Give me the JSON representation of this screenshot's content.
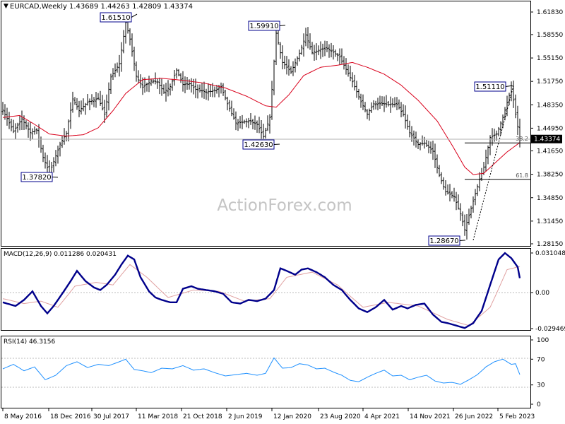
{
  "header": {
    "symbol": "EURCAD,Weekly",
    "ohlc": "1.43689 1.44263 1.42809 1.43374",
    "menu_glyph": "▼"
  },
  "watermark": "ActionForex.com",
  "colors": {
    "price": "#000000",
    "sma": "#d9001b",
    "macd": "#00008b",
    "signal": "#e0a0a0",
    "rsi": "#1e90ff",
    "label_border": "#00008b",
    "current_price_bg": "#000000"
  },
  "chart_data": [
    {
      "type": "bar",
      "title": "EURCAD,Weekly",
      "x_tick_labels": [
        "8 May 2016",
        "18 Dec 2016",
        "30 Jul 2017",
        "11 Mar 2018",
        "21 Oct 2018",
        "2 Jun 2019",
        "12 Jan 2020",
        "23 Aug 2020",
        "4 Apr 2021",
        "14 Nov 2021",
        "26 Jun 2022",
        "5 Feb 2023"
      ],
      "y_tick_labels": [
        "1.61830",
        "1.58550",
        "1.55150",
        "1.51750",
        "1.48350",
        "1.44950",
        "1.41650",
        "1.38250",
        "1.34850",
        "1.31450",
        "1.28150"
      ],
      "ylim": [
        1.2815,
        1.6183
      ],
      "current_price": "1.43374",
      "price_anchors": [
        [
          0,
          1.4757
        ],
        [
          5,
          1.445
        ],
        [
          9,
          1.463
        ],
        [
          13,
          1.443
        ],
        [
          16,
          1.4467
        ],
        [
          19,
          1.407
        ],
        [
          22,
          1.385
        ],
        [
          24,
          1.401
        ],
        [
          27,
          1.4264
        ],
        [
          30,
          1.442
        ],
        [
          33,
          1.492
        ],
        [
          36,
          1.475
        ],
        [
          40,
          1.487
        ],
        [
          45,
          1.493
        ],
        [
          48,
          1.47
        ],
        [
          51,
          1.524
        ],
        [
          55,
          1.543
        ],
        [
          58,
          1.603
        ],
        [
          60,
          1.579
        ],
        [
          63,
          1.525
        ],
        [
          66,
          1.509
        ],
        [
          70,
          1.518
        ],
        [
          73,
          1.517
        ],
        [
          76,
          1.502
        ],
        [
          79,
          1.51
        ],
        [
          82,
          1.534
        ],
        [
          85,
          1.513
        ],
        [
          88,
          1.514
        ],
        [
          91,
          1.506
        ],
        [
          96,
          1.502
        ],
        [
          100,
          1.504
        ],
        [
          103,
          1.51
        ],
        [
          106,
          1.485
        ],
        [
          110,
          1.457
        ],
        [
          113,
          1.458
        ],
        [
          116,
          1.46
        ],
        [
          120,
          1.455
        ],
        [
          123,
          1.437
        ],
        [
          126,
          1.465
        ],
        [
          129,
          1.5875
        ],
        [
          132,
          1.545
        ],
        [
          136,
          1.531
        ],
        [
          140,
          1.558
        ],
        [
          143,
          1.585
        ],
        [
          146,
          1.559
        ],
        [
          150,
          1.564
        ],
        [
          153,
          1.565
        ],
        [
          156,
          1.56
        ],
        [
          159,
          1.553
        ],
        [
          162,
          1.535
        ],
        [
          165,
          1.517
        ],
        [
          169,
          1.488
        ],
        [
          172,
          1.47
        ],
        [
          175,
          1.485
        ],
        [
          179,
          1.485
        ],
        [
          183,
          1.484
        ],
        [
          186,
          1.484
        ],
        [
          189,
          1.469
        ],
        [
          192,
          1.443
        ],
        [
          196,
          1.426
        ],
        [
          199,
          1.428
        ],
        [
          203,
          1.416
        ],
        [
          206,
          1.381
        ],
        [
          209,
          1.357
        ],
        [
          213,
          1.35
        ],
        [
          216,
          1.325
        ],
        [
          218,
          1.302
        ],
        [
          221,
          1.333
        ],
        [
          224,
          1.365
        ],
        [
          227,
          1.393
        ],
        [
          230,
          1.436
        ],
        [
          233,
          1.441
        ],
        [
          236,
          1.465
        ],
        [
          239,
          1.497
        ],
        [
          240,
          1.511
        ],
        [
          242,
          1.47
        ],
        [
          244,
          1.4337
        ]
      ],
      "sma_anchors": [
        [
          0,
          1.465
        ],
        [
          8,
          1.468
        ],
        [
          15,
          1.455
        ],
        [
          22,
          1.441
        ],
        [
          30,
          1.438
        ],
        [
          38,
          1.44
        ],
        [
          45,
          1.45
        ],
        [
          52,
          1.475
        ],
        [
          58,
          1.5
        ],
        [
          66,
          1.52
        ],
        [
          75,
          1.522
        ],
        [
          85,
          1.519
        ],
        [
          95,
          1.515
        ],
        [
          105,
          1.508
        ],
        [
          115,
          1.496
        ],
        [
          124,
          1.482
        ],
        [
          129,
          1.48
        ],
        [
          135,
          1.498
        ],
        [
          142,
          1.526
        ],
        [
          150,
          1.538
        ],
        [
          158,
          1.541
        ],
        [
          165,
          1.545
        ],
        [
          172,
          1.538
        ],
        [
          180,
          1.528
        ],
        [
          188,
          1.512
        ],
        [
          196,
          1.49
        ],
        [
          205,
          1.46
        ],
        [
          212,
          1.425
        ],
        [
          218,
          1.393
        ],
        [
          222,
          1.382
        ],
        [
          227,
          1.384
        ],
        [
          232,
          1.398
        ],
        [
          238,
          1.415
        ],
        [
          244,
          1.4286
        ]
      ],
      "annotations": [
        {
          "label": "1.61510",
          "price": 1.6151
        },
        {
          "label": "1.59910",
          "price": 1.5991
        },
        {
          "label": "1.51110",
          "price": 1.5111
        },
        {
          "label": "1.42630",
          "price": 1.4263
        },
        {
          "label": "1.37820",
          "price": 1.3782
        },
        {
          "label": "1.28670",
          "price": 1.2867
        }
      ],
      "fib_levels": [
        {
          "label": "38.2",
          "price": 1.4281
        },
        {
          "label": "61.8",
          "price": 1.3751
        }
      ]
    },
    {
      "type": "line",
      "title": "MACD(12,26,9) 0.011286 0.020431",
      "series": [
        {
          "name": "MACD"
        },
        {
          "name": "Signal"
        }
      ],
      "ylim": [
        -0.029469,
        0.031048
      ],
      "y_tick_labels": [
        "0.031048",
        "0.00",
        "-0.029469"
      ],
      "macd_anchors": [
        [
          0,
          -0.008
        ],
        [
          6,
          -0.011
        ],
        [
          10,
          -0.006
        ],
        [
          14,
          0.001
        ],
        [
          18,
          -0.011
        ],
        [
          21,
          -0.017
        ],
        [
          24,
          -0.011
        ],
        [
          28,
          -0.001
        ],
        [
          32,
          0.009
        ],
        [
          35,
          0.017
        ],
        [
          39,
          0.009
        ],
        [
          43,
          0.004
        ],
        [
          46,
          0.002
        ],
        [
          49,
          0.006
        ],
        [
          53,
          0.014
        ],
        [
          56,
          0.022
        ],
        [
          59,
          0.029
        ],
        [
          62,
          0.026
        ],
        [
          65,
          0.012
        ],
        [
          69,
          0.001
        ],
        [
          72,
          -0.004
        ],
        [
          75,
          -0.006
        ],
        [
          79,
          -0.008
        ],
        [
          82,
          -0.008
        ],
        [
          85,
          0.003
        ],
        [
          89,
          0.005
        ],
        [
          92,
          0.003
        ],
        [
          96,
          0.002
        ],
        [
          100,
          0.001
        ],
        [
          104,
          -0.001
        ],
        [
          108,
          -0.008
        ],
        [
          112,
          -0.009
        ],
        [
          116,
          -0.006
        ],
        [
          120,
          -0.007
        ],
        [
          124,
          -0.005
        ],
        [
          128,
          0.002
        ],
        [
          131,
          0.019
        ],
        [
          134,
          0.017
        ],
        [
          138,
          0.014
        ],
        [
          141,
          0.018
        ],
        [
          144,
          0.019
        ],
        [
          148,
          0.016
        ],
        [
          152,
          0.012
        ],
        [
          156,
          0.006
        ],
        [
          160,
          0.002
        ],
        [
          164,
          -0.006
        ],
        [
          168,
          -0.013
        ],
        [
          172,
          -0.016
        ],
        [
          176,
          -0.012
        ],
        [
          180,
          -0.006
        ],
        [
          184,
          -0.014
        ],
        [
          188,
          -0.011
        ],
        [
          191,
          -0.013
        ],
        [
          195,
          -0.01
        ],
        [
          199,
          -0.009
        ],
        [
          203,
          -0.018
        ],
        [
          207,
          -0.024
        ],
        [
          210,
          -0.025
        ],
        [
          214,
          -0.027
        ],
        [
          218,
          -0.029
        ],
        [
          222,
          -0.025
        ],
        [
          226,
          -0.015
        ],
        [
          230,
          0.006
        ],
        [
          234,
          0.026
        ],
        [
          237,
          0.031
        ],
        [
          240,
          0.027
        ],
        [
          243,
          0.02
        ],
        [
          244,
          0.0113
        ]
      ],
      "signal_anchors": [
        [
          0,
          -0.005
        ],
        [
          10,
          -0.009
        ],
        [
          18,
          -0.007
        ],
        [
          26,
          -0.012
        ],
        [
          34,
          0.005
        ],
        [
          44,
          0.008
        ],
        [
          52,
          0.006
        ],
        [
          60,
          0.022
        ],
        [
          68,
          0.012
        ],
        [
          78,
          -0.004
        ],
        [
          90,
          0.002
        ],
        [
          102,
          0.001
        ],
        [
          114,
          -0.007
        ],
        [
          126,
          -0.005
        ],
        [
          134,
          0.012
        ],
        [
          146,
          0.016
        ],
        [
          158,
          0.006
        ],
        [
          170,
          -0.012
        ],
        [
          182,
          -0.008
        ],
        [
          196,
          -0.011
        ],
        [
          210,
          -0.022
        ],
        [
          220,
          -0.027
        ],
        [
          230,
          -0.012
        ],
        [
          238,
          0.018
        ],
        [
          244,
          0.0204
        ]
      ]
    },
    {
      "type": "line",
      "title": "RSI(14) 46.3156",
      "series": [
        {
          "name": "RSI"
        }
      ],
      "ylim": [
        0,
        100
      ],
      "y_tick_labels": [
        "100",
        "70",
        "30",
        "0"
      ],
      "rsi_anchors": [
        [
          0,
          55
        ],
        [
          5,
          62
        ],
        [
          10,
          52
        ],
        [
          15,
          58
        ],
        [
          20,
          38
        ],
        [
          25,
          45
        ],
        [
          30,
          60
        ],
        [
          35,
          66
        ],
        [
          40,
          57
        ],
        [
          45,
          62
        ],
        [
          50,
          60
        ],
        [
          55,
          66
        ],
        [
          58,
          70
        ],
        [
          62,
          54
        ],
        [
          66,
          52
        ],
        [
          70,
          49
        ],
        [
          75,
          56
        ],
        [
          80,
          55
        ],
        [
          85,
          60
        ],
        [
          90,
          53
        ],
        [
          95,
          55
        ],
        [
          100,
          49
        ],
        [
          105,
          44
        ],
        [
          110,
          46
        ],
        [
          115,
          48
        ],
        [
          120,
          45
        ],
        [
          124,
          48
        ],
        [
          128,
          72
        ],
        [
          132,
          56
        ],
        [
          136,
          57
        ],
        [
          140,
          63
        ],
        [
          144,
          61
        ],
        [
          148,
          55
        ],
        [
          152,
          56
        ],
        [
          156,
          50
        ],
        [
          160,
          45
        ],
        [
          164,
          37
        ],
        [
          168,
          35
        ],
        [
          172,
          42
        ],
        [
          176,
          48
        ],
        [
          180,
          53
        ],
        [
          184,
          44
        ],
        [
          188,
          45
        ],
        [
          192,
          38
        ],
        [
          196,
          42
        ],
        [
          200,
          45
        ],
        [
          204,
          36
        ],
        [
          208,
          33
        ],
        [
          212,
          34
        ],
        [
          216,
          31
        ],
        [
          220,
          38
        ],
        [
          224,
          46
        ],
        [
          228,
          58
        ],
        [
          232,
          66
        ],
        [
          236,
          70
        ],
        [
          240,
          62
        ],
        [
          242,
          63
        ],
        [
          244,
          46
        ]
      ]
    }
  ]
}
